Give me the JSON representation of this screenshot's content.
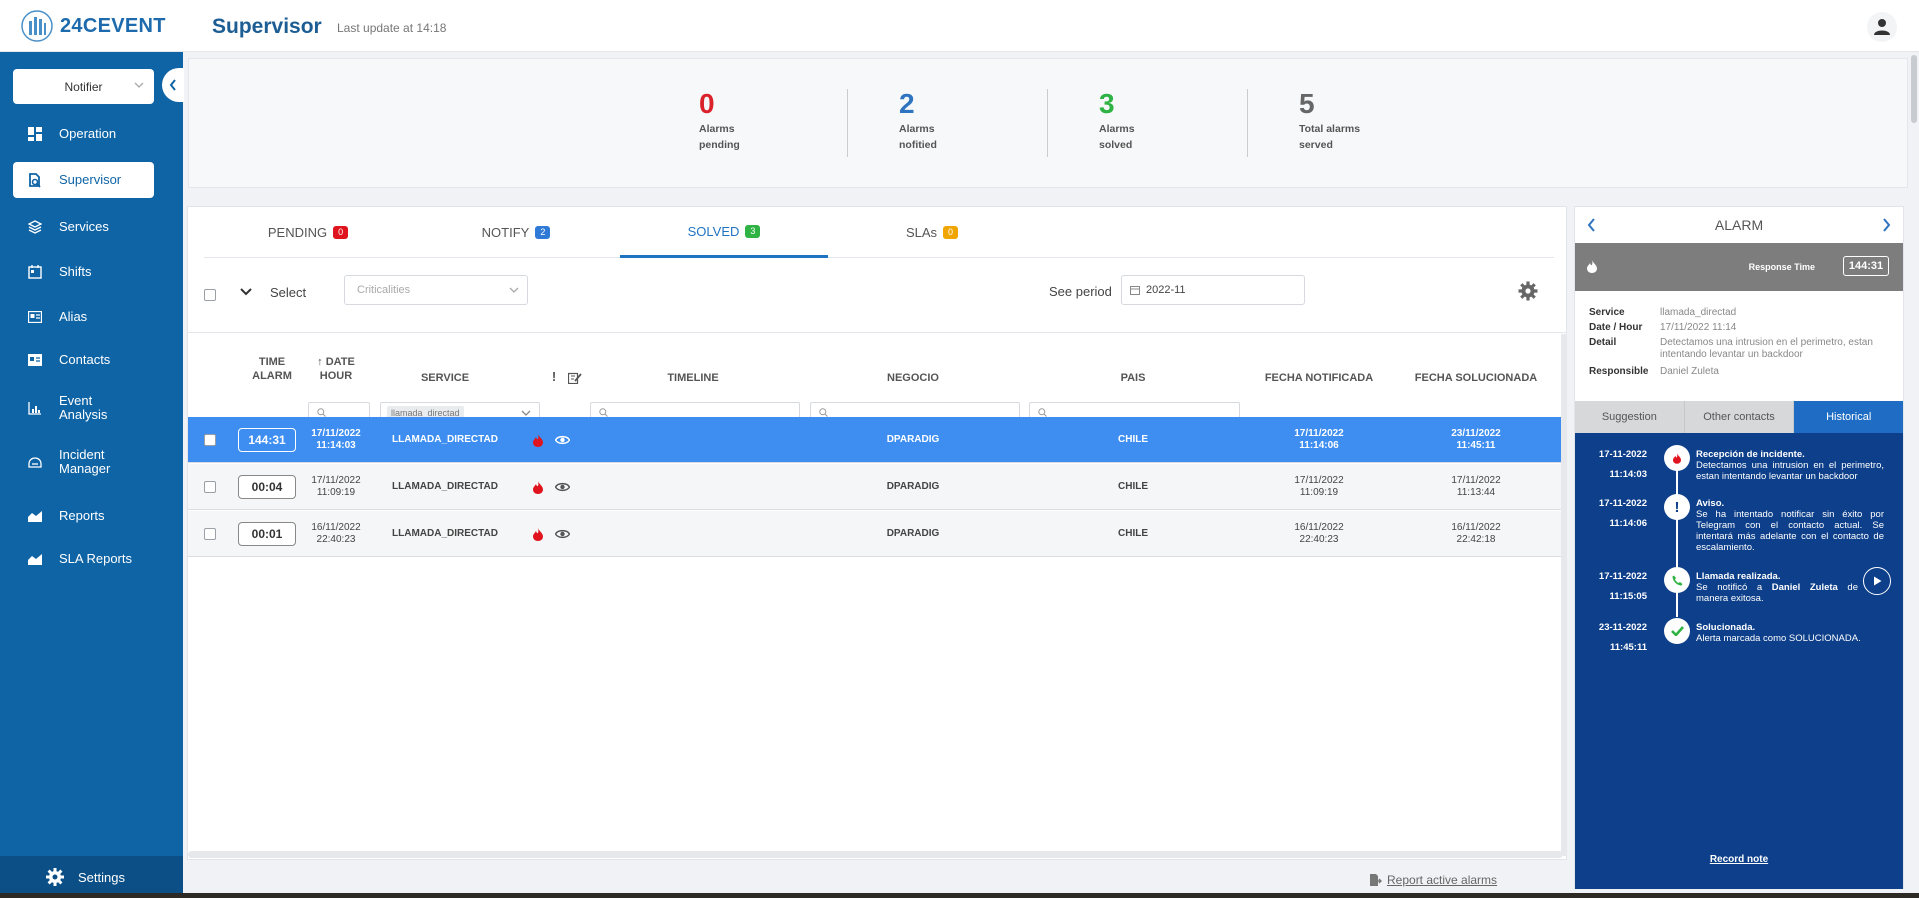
{
  "header": {
    "logo_text": "24CEVENT",
    "title": "Supervisor",
    "last_update": "Last update at 14:18"
  },
  "sidebar": {
    "notifier": "Notifier",
    "items": [
      {
        "label": "Operation",
        "icon": "dashboard-icon"
      },
      {
        "label": "Supervisor",
        "icon": "supervisor-icon"
      },
      {
        "label": "Services",
        "icon": "layers-icon"
      },
      {
        "label": "Shifts",
        "icon": "calendar-icon"
      },
      {
        "label": "Alias",
        "icon": "id-card-icon"
      },
      {
        "label": "Contacts",
        "icon": "contact-card-icon"
      },
      {
        "label": "Event Analysis",
        "icon": "bar-chart-icon"
      },
      {
        "label": "Incident Manager",
        "icon": "incident-icon"
      },
      {
        "label": "Reports",
        "icon": "area-chart-icon"
      },
      {
        "label": "SLA Reports",
        "icon": "area-chart-icon"
      }
    ],
    "settings": "Settings"
  },
  "stats": [
    {
      "value": "0",
      "label1": "Alarms",
      "label2": "pending",
      "color": "#d9222a"
    },
    {
      "value": "2",
      "label1": "Alarms",
      "label2": "nofitied",
      "color": "#2f74c0"
    },
    {
      "value": "3",
      "label1": "Alarms",
      "label2": "solved",
      "color": "#2fb344"
    },
    {
      "value": "5",
      "label1": "Total alarms",
      "label2": "served",
      "color": "#666666"
    }
  ],
  "tabs": [
    {
      "label": "PENDING",
      "count": "0",
      "color": "#e0141e"
    },
    {
      "label": "NOTIFY",
      "count": "2",
      "color": "#2f7ad6"
    },
    {
      "label": "SOLVED",
      "count": "3",
      "color": "#2fb344"
    },
    {
      "label": "SLAs",
      "count": "0",
      "color": "#f0a500"
    }
  ],
  "active_tab": "SOLVED",
  "toolbar": {
    "select_label": "Select",
    "criticalities_placeholder": "Criticalities",
    "period_label": "See period",
    "period_value": "2022-11"
  },
  "table": {
    "headers": {
      "time_alarm_1": "TIME",
      "time_alarm_2": "ALARM",
      "date_hour_1": "↑ DATE",
      "date_hour_2": "HOUR",
      "service": "SERVICE",
      "timeline": "TIMELINE",
      "negocio": "NEGOCIO",
      "pais": "PAIS",
      "fecha_notificada": "FECHA NOTIFICADA",
      "fecha_solucionada": "FECHA SOLUCIONADA"
    },
    "service_filter_chip": "llamada_directad",
    "rows": [
      {
        "timer": "144:31",
        "date": "17/11/2022",
        "hour": "11:14:03",
        "service": "LLAMADA_DIRECTAD",
        "negocio": "DPARADIG",
        "pais": "CHILE",
        "notif_date": "17/11/2022",
        "notif_hour": "11:14:06",
        "sol_date": "23/11/2022",
        "sol_hour": "11:45:11"
      },
      {
        "timer": "00:04",
        "date": "17/11/2022",
        "hour": "11:09:19",
        "service": "LLAMADA_DIRECTAD",
        "negocio": "DPARADIG",
        "pais": "CHILE",
        "notif_date": "17/11/2022",
        "notif_hour": "11:09:19",
        "sol_date": "17/11/2022",
        "sol_hour": "11:13:44"
      },
      {
        "timer": "00:01",
        "date": "16/11/2022",
        "hour": "22:40:23",
        "service": "LLAMADA_DIRECTAD",
        "negocio": "DPARADIG",
        "pais": "CHILE",
        "notif_date": "16/11/2022",
        "notif_hour": "22:40:23",
        "sol_date": "16/11/2022",
        "sol_hour": "22:42:18"
      }
    ],
    "report_link": "Report active alarms"
  },
  "alarm_panel": {
    "title": "ALARM",
    "response_time_label": "Response Time",
    "response_time": "144:31",
    "info": [
      {
        "k": "Service",
        "v": "llamada_directad"
      },
      {
        "k": "Date / Hour",
        "v": "17/11/2022 11:14"
      },
      {
        "k": "Detail",
        "v": "Detectamos una intrusion en el perimetro, estan intentando levantar un backdoor"
      },
      {
        "k": "Responsible",
        "v": "Daniel Zuleta"
      }
    ],
    "tabs": [
      "Suggestion",
      "Other contacts",
      "Historical"
    ],
    "history": [
      {
        "date": "17-11-2022",
        "time": "11:14:03",
        "title": "Recepción de incidente.",
        "text": "Detectamos una intrusion en el perimetro, estan intentando levantar un backdoor",
        "icon": "fire-icon"
      },
      {
        "date": "17-11-2022",
        "time": "11:14:06",
        "title": "Aviso.",
        "text": "Se ha intentado notificar sin éxito por Telegram con el contacto actual. Se intentará más adelante con el contacto de escalamiento.",
        "icon": "exclamation-icon"
      },
      {
        "date": "17-11-2022",
        "time": "11:15:05",
        "title": "Llamada realizada.",
        "text_pre": "Se notificó a ",
        "text_bold": "Daniel Zuleta",
        "text_post": " de manera exitosa.",
        "icon": "phone-icon"
      },
      {
        "date": "23-11-2022",
        "time": "11:45:11",
        "title": "Solucionada.",
        "text": "Alerta marcada como SOLUCIONADA.",
        "icon": "check-icon"
      }
    ],
    "record_note": "Record note"
  },
  "colors": {
    "sidebar": "#0f64a6",
    "selected_row": "#3d8ef0",
    "history_bg": "#0d3f8a",
    "fire": "#e0141e",
    "phone": "#2fb344"
  }
}
